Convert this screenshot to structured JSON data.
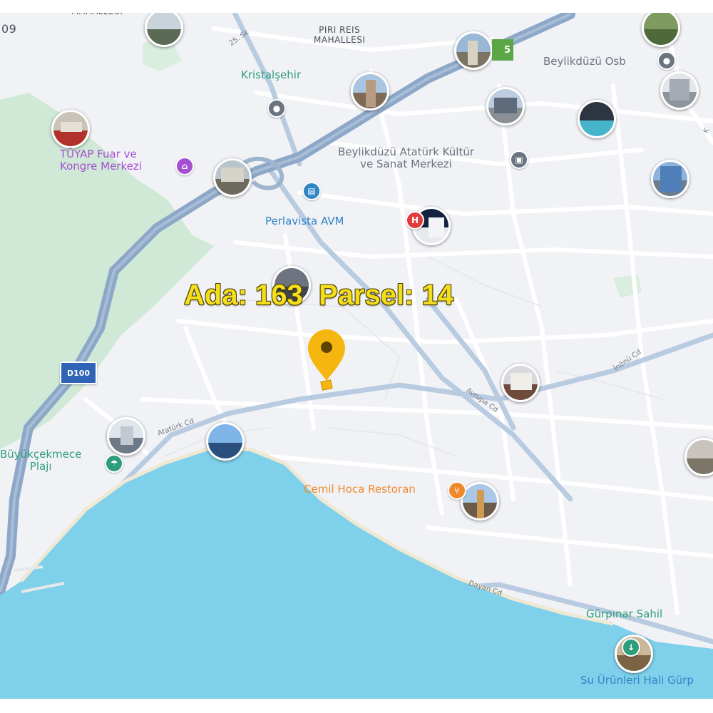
{
  "map": {
    "colors": {
      "land": "#f1f2f5",
      "park": "#cfe9d6",
      "sea": "#7fd0ea",
      "road_major": "#aec3db",
      "road_minor": "#ffffff",
      "highway": "#8ca7c8",
      "pin": "#f5b60f"
    },
    "parcel_label": "Ada: 163  Parsel: 14",
    "marker_icon": "location-pin-icon",
    "areas": {
      "piri_reis_line1": "PIRI REIS",
      "piri_reis_line2": "MAHALLESI",
      "top_left_fragment": "MAHALLESI",
      "left_edge_fragment": "09"
    },
    "pois": {
      "kristalsehir": "Kristalşehir",
      "tuyap_line1": "TÜYAP Fuar ve",
      "tuyap_line2": "Kongre Merkezi",
      "beylikduzu_osb": "Beylikdüzü Osb",
      "ataturk_kultur_line1": "Beylikdüzü Atatürk Kültür",
      "ataturk_kultur_line2": "ve Sanat Merkezi",
      "perlavista": "Perlavista AVM",
      "buyukcekmece_line1": "Büyükçekmece",
      "buyukcekmece_line2": "Plajı",
      "cemil_hoca": "Cemil Hoca Restoran",
      "gurpinar_sahil": "Gürpınar Sahil",
      "su_urunleri": "Su Ürünleri Hali Gürp"
    },
    "streets": {
      "s25": "25. Sk",
      "ataturk_cd": "Atatürk Cd",
      "avrupa_cd": "Avrupa Cd",
      "inonu_cd": "İnönü Cd",
      "dayan_cd": "Dayan Cd",
      "k_fragment": "K"
    },
    "shields": {
      "d100": "D100",
      "exit": "5"
    }
  }
}
